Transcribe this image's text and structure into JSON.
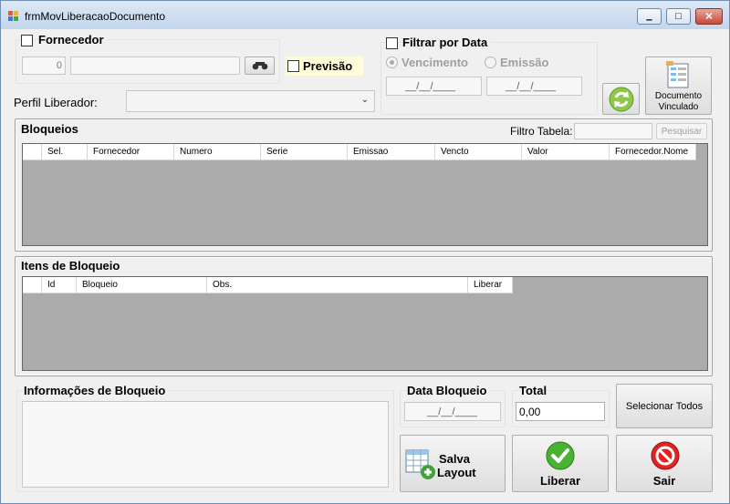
{
  "window": {
    "title": "frmMovLiberacaoDocumento",
    "controls": {
      "minimize": "▁",
      "maximize": "□",
      "close": "✕"
    }
  },
  "fornecedor": {
    "label": "Fornecedor",
    "code_value": "0",
    "name_value": "",
    "search_icon": "binoculars-icon"
  },
  "previsao": {
    "label": "Previsão"
  },
  "filtro_data": {
    "label": "Filtrar por Data",
    "options": [
      "Vencimento",
      "Emissão"
    ],
    "date_from": "__/__/____",
    "date_to": "__/__/____"
  },
  "perfil": {
    "label": "Perfil Liberador:",
    "selected": ""
  },
  "refresh_icon": "refresh-icon",
  "documento_vinculado": {
    "label_line1": "Documento",
    "label_line2": "Vinculado",
    "icon": "document-icon"
  },
  "bloqueios": {
    "title": "Bloqueios",
    "filter_label": "Filtro Tabela:",
    "filter_value": "",
    "search_button": "Pesquisar",
    "columns": [
      "Sel.",
      "Fornecedor",
      "Numero",
      "Serie",
      "Emissao",
      "Vencto",
      "Valor",
      "Fornecedor.Nome"
    ]
  },
  "itens": {
    "title": "Itens de Bloqueio",
    "columns": [
      "Id",
      "Bloqueio",
      "Obs.",
      "Liberar"
    ]
  },
  "info": {
    "title": "Informações de Bloqueio",
    "value": ""
  },
  "data_bloqueio": {
    "title": "Data Bloqueio",
    "value": "__/__/____"
  },
  "total": {
    "title": "Total",
    "value": "0,00"
  },
  "buttons": {
    "selecionar_todos": "Selecionar Todos",
    "salva_layout_line1": "Salva",
    "salva_layout_line2": "Layout",
    "liberar": "Liberar",
    "sair": "Sair"
  },
  "colors": {
    "accent": "#6d8fb4",
    "grid_bg": "#ababab",
    "ok_green": "#3c9d2c",
    "exit_red": "#d41e1e"
  }
}
